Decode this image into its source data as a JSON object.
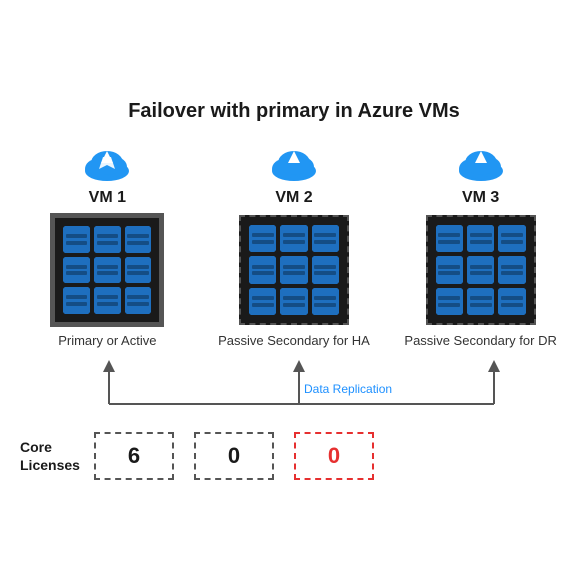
{
  "title": "Failover with primary in Azure VMs",
  "vms": [
    {
      "id": "vm1",
      "label": "VM 1",
      "caption": "Primary or Active",
      "border_type": "solid",
      "license_value": "6",
      "license_border": "dashed-black"
    },
    {
      "id": "vm2",
      "label": "VM 2",
      "caption": "Passive Secondary for HA",
      "border_type": "dashed",
      "license_value": "0",
      "license_border": "dashed-black"
    },
    {
      "id": "vm3",
      "label": "VM 3",
      "caption": "Passive Secondary for DR",
      "border_type": "dashed",
      "license_value": "0",
      "license_border": "dashed-red"
    }
  ],
  "data_replication_label": "Data Replication",
  "licenses_label": "Core\nLicenses"
}
